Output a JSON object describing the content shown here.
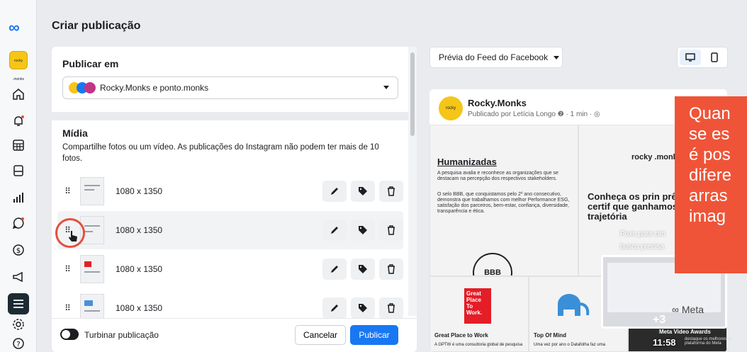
{
  "app": {
    "title": "Criar publicação",
    "brand_short": "rocky .monks"
  },
  "sidebar": {
    "items": [
      "meta-logo",
      "avatar",
      "home",
      "notifications",
      "grid",
      "content",
      "insights",
      "inbox",
      "billing",
      "ads",
      "menu",
      "settings",
      "help"
    ]
  },
  "publish_in": {
    "title": "Publicar em",
    "selected": "Rocky.Monks e ponto.monks"
  },
  "media": {
    "title": "Mídia",
    "description": "Compartilhe fotos ou um vídeo. As publicações do Instagram não podem ter mais de 10 fotos.",
    "items": [
      {
        "dims": "1080 x 1350"
      },
      {
        "dims": "1080 x 1350"
      },
      {
        "dims": "1080 x 1350"
      },
      {
        "dims": "1080 x 1350"
      }
    ]
  },
  "footer": {
    "boost_label": "Turbinar publicação",
    "cancel_label": "Cancelar",
    "publish_label": "Publicar"
  },
  "preview": {
    "selector": "Prévia do Feed do Facebook",
    "page_name": "Rocky.Monks",
    "page_sub": "Publicado por Letícia Longo ❷ · 1 min · ◎",
    "tile1_heading": "Humanizadas",
    "tile1_p1": "A pesquisa avalia e reconhece as organizações que se destacam na percepção dos respectivos stakeholders.",
    "tile1_p2": "O selo BBB, que conquistamos pelo 2º ano consecutivo, demonstra que trabalhamos com melhor Performance ESG, satisfação dos parceiros, bem-estar, confiança, diversidade, transparência e ética.",
    "seal": "BBB",
    "tile2_logo": "rocky .monks",
    "tile2_heading": "Conheça os prin prêmios e certif que ganhamos o nossa trajetória",
    "hint1": "Puxe para cim",
    "hint2": "busca precisa",
    "gptw": "Great Place To Work.",
    "gptw_title": "Great Place to Work",
    "gptw_text": "A GPTW é uma consultoria global de pesquisa",
    "topmind_title": "Top Of Mind",
    "topmind_text": "Uma vez por ano o Datafolha faz uma",
    "award_title": "Meta Video Awards",
    "award_text": "destaque os melhores da plataforma do Meta",
    "pip_meta": "∞ Meta",
    "pip_plus": "+3",
    "time": "11:58"
  },
  "overlay": {
    "lines": [
      "Quan",
      "se es",
      "é pos",
      "difere",
      "arras",
      "imag"
    ]
  },
  "colors": {
    "accent": "#1877f2",
    "highlight": "#ef5438",
    "ring": "#e3503e",
    "brand_yellow": "#f5c518"
  }
}
